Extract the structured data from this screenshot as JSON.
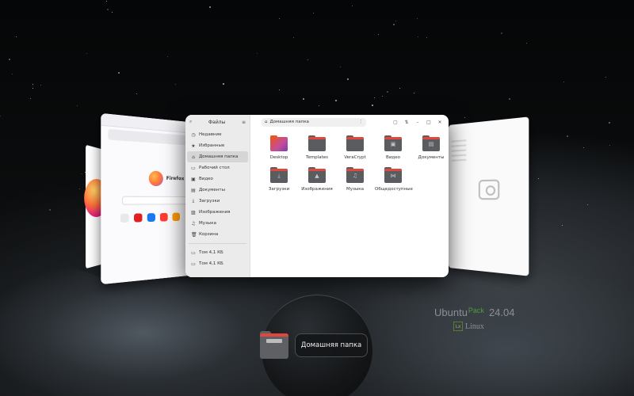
{
  "files_window": {
    "sidebar_title": "Файлы",
    "path_label": "Домашняя папка",
    "sidebar_items": [
      {
        "icon": "clock-icon",
        "glyph": "◷",
        "label": "Недавние"
      },
      {
        "icon": "star-icon",
        "glyph": "★",
        "label": "Избранные"
      },
      {
        "icon": "home-icon",
        "glyph": "⌂",
        "label": "Домашняя папка",
        "active": true
      },
      {
        "icon": "desktop-icon",
        "glyph": "▭",
        "label": "Рабочий стол"
      },
      {
        "icon": "video-icon",
        "glyph": "▣",
        "label": "Видео"
      },
      {
        "icon": "document-icon",
        "glyph": "▤",
        "label": "Документы"
      },
      {
        "icon": "download-icon",
        "glyph": "⤓",
        "label": "Загрузки"
      },
      {
        "icon": "image-icon",
        "glyph": "▨",
        "label": "Изображения"
      },
      {
        "icon": "music-icon",
        "glyph": "♫",
        "label": "Музыка"
      },
      {
        "icon": "trash-icon",
        "glyph": "🗑",
        "label": "Корзина"
      }
    ],
    "volumes": [
      {
        "icon": "drive-icon",
        "label": "Том 4,1 КБ"
      },
      {
        "icon": "drive-icon",
        "label": "Том 4,1 КБ"
      }
    ],
    "folders": [
      {
        "name": "Desktop",
        "kind": "desktop",
        "glyph": ""
      },
      {
        "name": "Templates",
        "kind": "plain",
        "glyph": ""
      },
      {
        "name": "VeraCrypt",
        "kind": "plain",
        "glyph": ""
      },
      {
        "name": "Видео",
        "kind": "plain",
        "glyph": "▣"
      },
      {
        "name": "Документы",
        "kind": "plain",
        "glyph": "▤"
      },
      {
        "name": "Загрузки",
        "kind": "plain",
        "glyph": "⤓"
      },
      {
        "name": "Изображения",
        "kind": "plain",
        "glyph": "▲"
      },
      {
        "name": "Музыка",
        "kind": "plain",
        "glyph": "♫"
      },
      {
        "name": "Общедоступные",
        "kind": "plain",
        "glyph": "⋈"
      }
    ]
  },
  "firefox_window": {
    "brand": "Firefox"
  },
  "dock": {
    "label": "Домашняя папка"
  },
  "branding": {
    "name": "Ubuntu",
    "accent": "Pack",
    "version": "24.04",
    "logo_text": "Linux"
  },
  "colors": {
    "folder_body": "#5b5c60",
    "folder_tab": "#e0473d",
    "accent_green": "#4f9a3a"
  }
}
